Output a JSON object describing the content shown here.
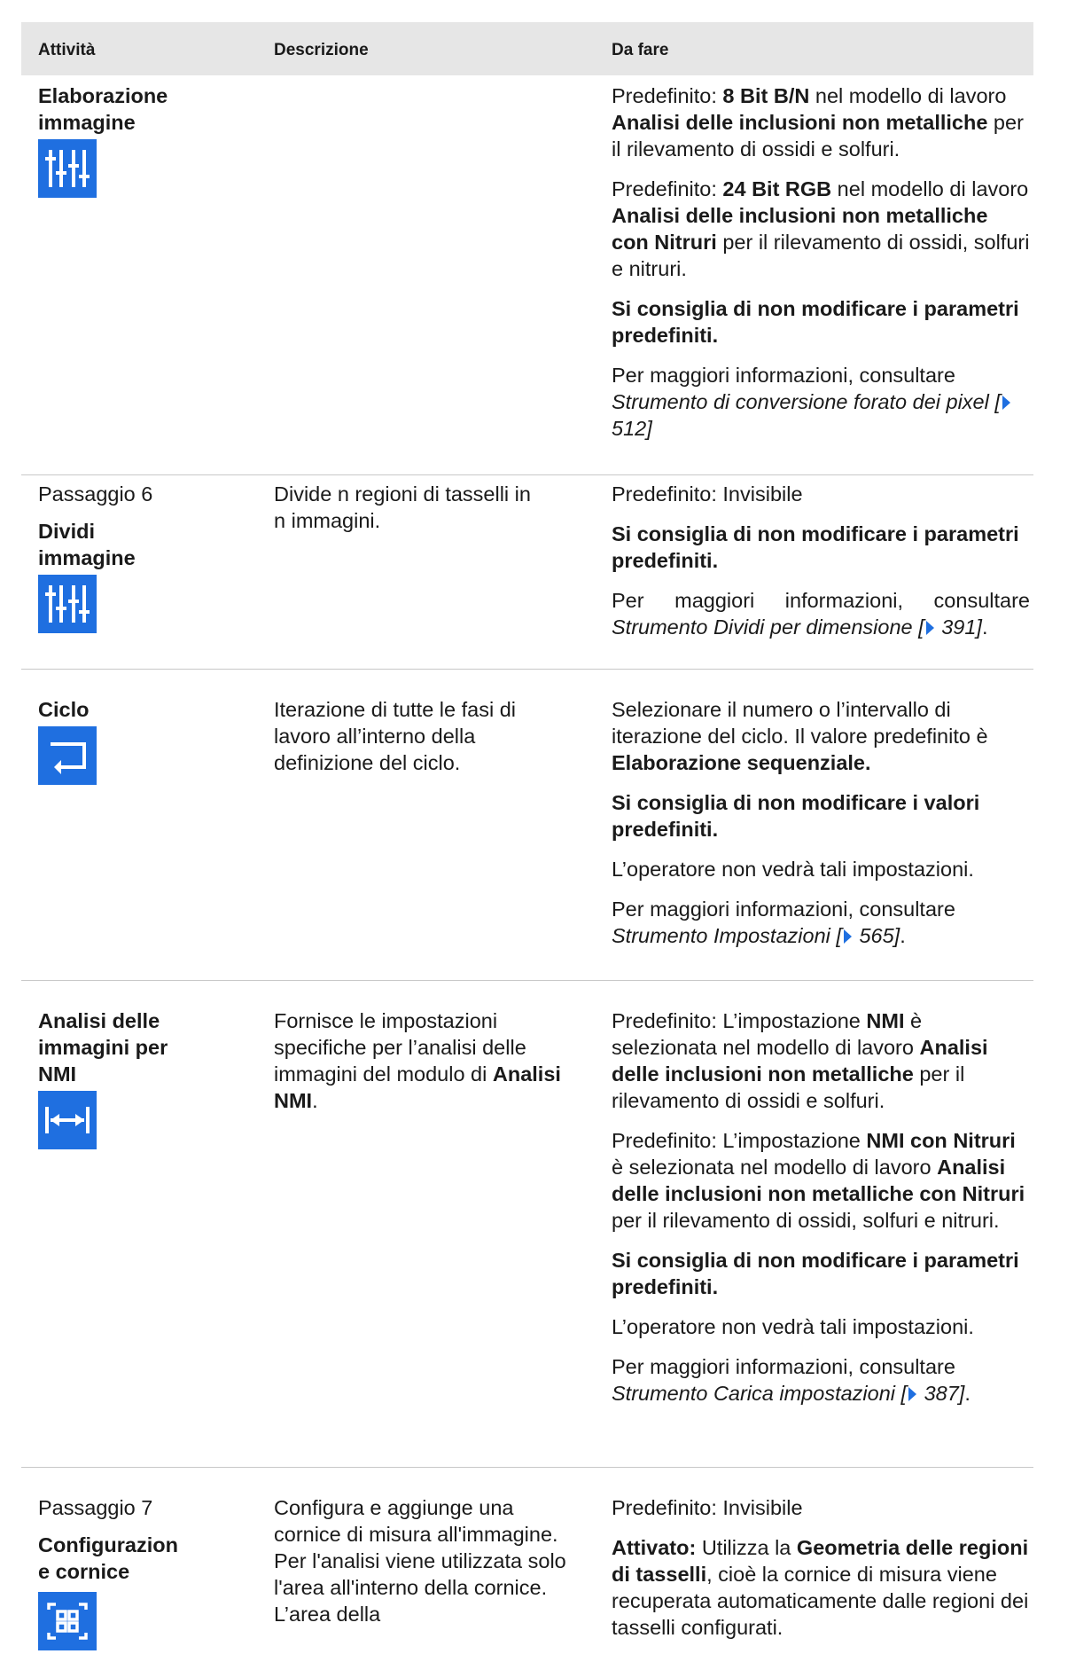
{
  "header": {
    "col_activity": "Attività",
    "col_description": "Descrizione",
    "col_todo": "Da fare"
  },
  "rows": [
    {
      "title": "Elaborazione immagine",
      "icon": "sliders-icon",
      "todo": {
        "p1_a": "Predefinito: ",
        "p1_b": "8 Bit B/N",
        "p1_c": " nel modello di lavoro ",
        "p1_d": "Analisi delle inclusioni non metalliche",
        "p1_e": " per il rilevamento di ossidi e solfuri.",
        "p2_a": "Predefinito: ",
        "p2_b": "24 Bit RGB",
        "p2_c": " nel modello di lavoro ",
        "p2_d": "Analisi delle inclusioni non metalliche con Nitruri",
        "p2_e": " per il rilevamento di ossidi, solfuri e nitruri.",
        "p3": "Si consiglia di non modificare i parametri predefiniti.",
        "p4_a": "Per maggiori informazioni, consultare ",
        "p4_link": "Strumento di conversione forato dei pixel [",
        "p4_page": "512]"
      }
    },
    {
      "step": "Passaggio 6",
      "title": "Dividi immagine",
      "icon": "sliders-icon",
      "description": "Divide n regioni di tasselli in n immagini.",
      "todo": {
        "p1": "Predefinito: Invisibile",
        "p2": "Si consiglia di non modificare i parametri predefiniti.",
        "p3_a": "Per maggiori informazioni, consultare ",
        "p3_link": "Strumento Dividi per dimensione [",
        "p3_page": " 391]",
        "p3_end": "."
      }
    },
    {
      "title": "Ciclo",
      "icon": "loop-icon",
      "description": "Iterazione di tutte le fasi di lavoro all’interno della definizione del ciclo.",
      "todo": {
        "p1_a": "Selezionare il numero o l’intervallo di iterazione del ciclo. Il valore predefinito è ",
        "p1_b": "Elaborazione sequenziale.",
        "p2": "Si consiglia di non modificare i valori predefiniti.",
        "p3": "L’operatore non vedrà tali impostazioni.",
        "p4_a": "Per maggiori informazioni, consultare ",
        "p4_link": "Strumento Impostazioni [",
        "p4_page": " 565]",
        "p4_end": "."
      }
    },
    {
      "title": "Analisi delle immagini per NMI",
      "icon": "measure-width-icon",
      "description_a": "Fornisce le impostazioni specifiche per l’analisi delle immagini del modulo di ",
      "description_b": "Analisi NMI",
      "description_c": ".",
      "todo": {
        "p1_a": "Predefinito: L’impostazione ",
        "p1_b": "NMI",
        "p1_c": " è selezionata nel modello di lavoro ",
        "p1_d": "Analisi delle inclusioni non metalliche",
        "p1_e": " per il rilevamento di ossidi e solfuri.",
        "p2_a": "Predefinito: L’impostazione ",
        "p2_b": "NMI con Nitruri",
        "p2_c": " è selezionata nel modello di lavoro ",
        "p2_d": "Analisi delle inclusioni non metalliche con Nitruri",
        "p2_e": " per il rilevamento di ossidi, solfuri e nitruri.",
        "p3": "Si consiglia di non modificare i parametri predefiniti.",
        "p4": "L’operatore non vedrà tali impostazioni.",
        "p5_a": "Per maggiori informazioni, consultare ",
        "p5_link": "Strumento Carica impostazioni [",
        "p5_page": " 387]",
        "p5_end": "."
      }
    },
    {
      "step": "Passaggio 7",
      "title": "Configurazion e cornice",
      "icon": "frame-icon",
      "description": "Configura e aggiunge una cornice di misura all'immagine. Per l'analisi viene utilizzata solo l'area all'interno della cornice. L’area della",
      "todo": {
        "p1": "Predefinito: Invisibile",
        "p2_a": "Attivato:",
        "p2_b": " Utilizza la ",
        "p2_c": "Geometria delle regioni di tasselli",
        "p2_d": ", cioè la cornice di misura viene recuperata automaticamente dalle regioni dei tasselli configurati."
      }
    }
  ],
  "colors": {
    "accent": "#1f6fe0",
    "header_bg": "#e6e6e6",
    "rule": "#c8c8c8"
  }
}
